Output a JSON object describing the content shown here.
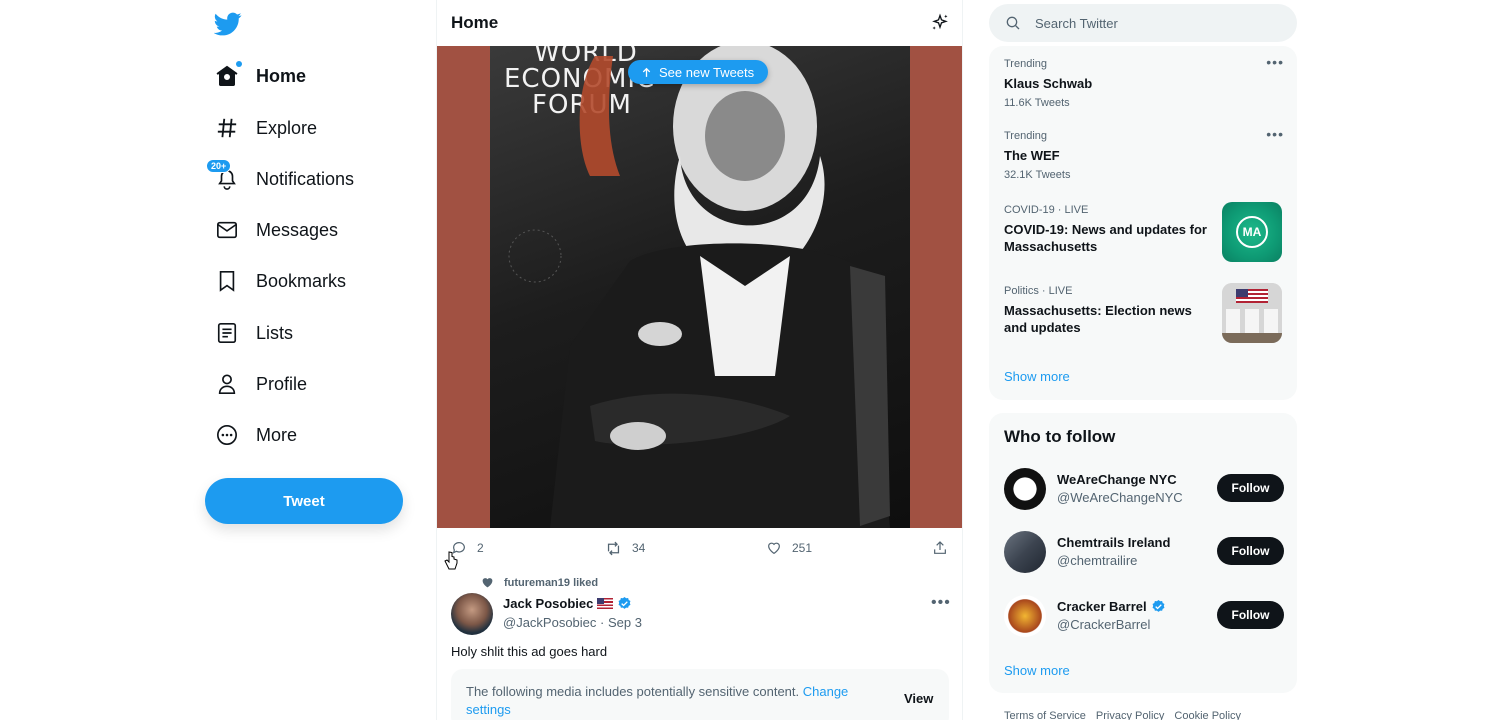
{
  "sidebar": {
    "items": [
      {
        "label": "Home",
        "icon": "home-icon"
      },
      {
        "label": "Explore",
        "icon": "hashtag-icon"
      },
      {
        "label": "Notifications",
        "icon": "bell-icon",
        "badge": "20+"
      },
      {
        "label": "Messages",
        "icon": "envelope-icon"
      },
      {
        "label": "Bookmarks",
        "icon": "bookmark-icon"
      },
      {
        "label": "Lists",
        "icon": "list-icon"
      },
      {
        "label": "Profile",
        "icon": "person-icon"
      },
      {
        "label": "More",
        "icon": "more-circle-icon"
      }
    ],
    "tweet_button": "Tweet"
  },
  "header": {
    "title": "Home"
  },
  "banner": {
    "new_tweets": "See new Tweets"
  },
  "media": {
    "poster_text": [
      "WORLD",
      "ECONOMIC",
      "FORUM"
    ]
  },
  "tweet1": {
    "replies": "2",
    "retweets": "34",
    "likes": "251"
  },
  "tweet2": {
    "social_context": "futureman19 liked",
    "name": "Jack Posobiec",
    "handle": "@JackPosobiec",
    "date": "· Sep 3",
    "text": "Holy shlit this ad goes hard",
    "sensitive_text": "The following media includes potentially sensitive content. ",
    "sensitive_link": "Change settings",
    "view_label": "View"
  },
  "search": {
    "placeholder": "Search Twitter"
  },
  "trends": [
    {
      "meta": "Trending",
      "title": "Klaus Schwab",
      "count": "11.6K Tweets"
    },
    {
      "meta": "Trending",
      "title": "The WEF",
      "count": "32.1K Tweets"
    },
    {
      "meta": "COVID-19 · LIVE",
      "title": "COVID-19: News and updates for Massachusetts"
    },
    {
      "meta": "Politics · LIVE",
      "title": "Massachusetts: Election news and updates"
    }
  ],
  "trends_show_more": "Show more",
  "ma_badge": "MA",
  "who_to_follow": {
    "title": "Who to follow",
    "accounts": [
      {
        "name": "WeAreChange NYC",
        "handle": "@WeAreChangeNYC",
        "button": "Follow"
      },
      {
        "name": "Chemtrails Ireland",
        "handle": "@chemtrailire",
        "button": "Follow"
      },
      {
        "name": "Cracker Barrel",
        "handle": "@CrackerBarrel",
        "button": "Follow"
      }
    ],
    "show_more": "Show more"
  },
  "footer": [
    "Terms of Service",
    "Privacy Policy",
    "Cookie Policy"
  ],
  "colors": {
    "accent": "#1d9bf0",
    "media_bg": "#a15142",
    "text": "#0f1419",
    "muted": "#536471"
  }
}
